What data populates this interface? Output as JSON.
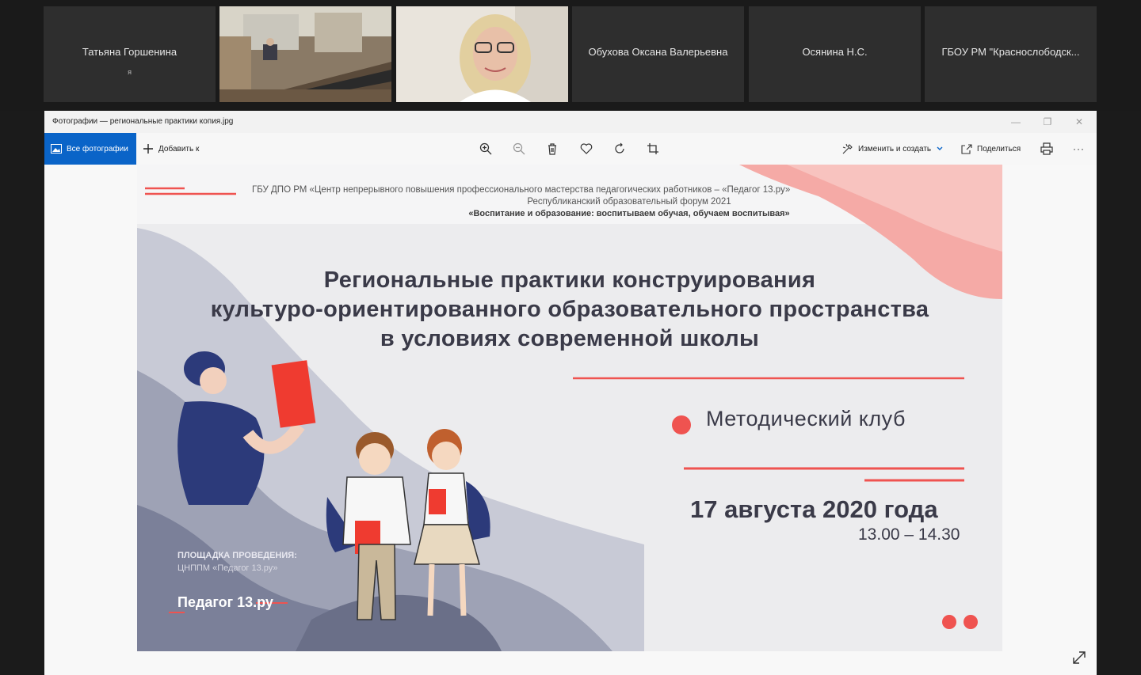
{
  "participants": [
    {
      "name": "Татьяна Горшенина",
      "sub": "я",
      "video": false
    },
    {
      "name": "",
      "video": true,
      "scene": "conference-room"
    },
    {
      "name": "",
      "video": true,
      "scene": "woman-webcam"
    },
    {
      "name": "Обухова Оксана Валерьевна",
      "video": false
    },
    {
      "name": "Осянина Н.С.",
      "video": false
    },
    {
      "name": "ГБОУ РМ \"Краснослободск...",
      "video": false
    }
  ],
  "window": {
    "title": "Фотографии — региональные практики копия.jpg",
    "controls": {
      "minimize": "—",
      "maximize": "❐",
      "close": "✕"
    }
  },
  "toolbar": {
    "all_photos": "Все фотографии",
    "add_to": "Добавить к",
    "edit_create": "Изменить и создать",
    "share": "Поделиться",
    "more": "···",
    "icons": [
      "zoom-in-icon",
      "zoom-out-icon",
      "delete-icon",
      "heart-icon",
      "rotate-icon",
      "crop-icon",
      "print-icon"
    ]
  },
  "slide": {
    "org": "ГБУ ДПО РМ «Центр непрерывного повышения профессионального мастерства педагогических работников – «Педагог 13.ру»",
    "forum": "Республиканский образовательный форум 2021",
    "theme": "«Воспитание и образование: воспитываем обучая, обучаем воспитывая»",
    "title_line1": "Региональные практики конструирования",
    "title_line2": "культуро-ориентированного образовательного пространства",
    "title_line3": "в условиях современной школы",
    "club": "Методический клуб",
    "date": "17 августа 2020 года",
    "time": "13.00 – 14.30",
    "venue_heading": "ПЛОЩАДКА ПРОВЕДЕНИЯ:",
    "venue": "ЦНППМ «Педагог 13.ру»",
    "brand": "Педагог 13.ру",
    "colors": {
      "accent": "#ef5350",
      "dark": "#3a3a48",
      "wave": "#7b8099"
    }
  }
}
